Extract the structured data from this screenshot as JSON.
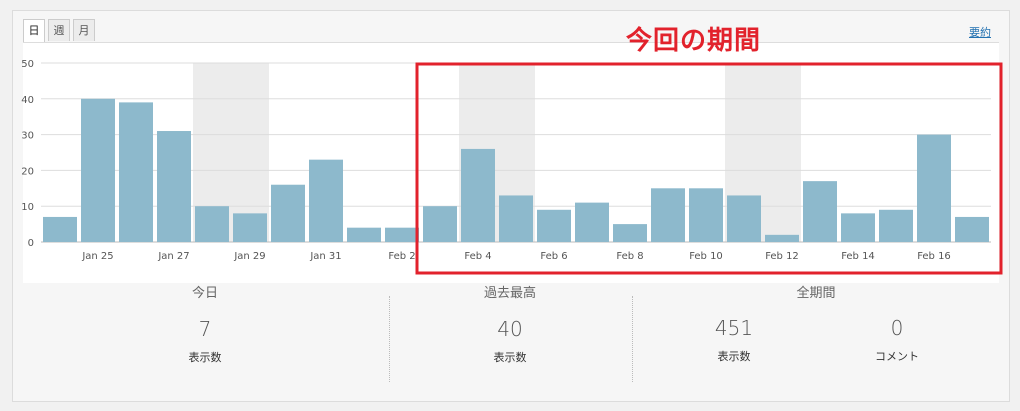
{
  "tabs": [
    {
      "label": "日",
      "active": true
    },
    {
      "label": "週",
      "active": false
    },
    {
      "label": "月",
      "active": false
    }
  ],
  "summary_link": "要約",
  "annotation": {
    "title": "今回の期間",
    "color": "#e2222c"
  },
  "chart_data": {
    "type": "bar",
    "ylim": [
      0,
      50
    ],
    "yticks": [
      0,
      10,
      20,
      30,
      40,
      50
    ],
    "x_tick_labels": [
      "Jan 25",
      "Jan 27",
      "Jan 29",
      "Jan 31",
      "Feb 2",
      "Feb 4",
      "Feb 6",
      "Feb 8",
      "Feb 10",
      "Feb 12",
      "Feb 14",
      "Feb 16"
    ],
    "values": [
      7,
      40,
      39,
      31,
      10,
      8,
      16,
      23,
      4,
      4,
      10,
      26,
      13,
      9,
      11,
      5,
      15,
      15,
      13,
      2,
      17,
      8,
      9,
      30,
      7
    ],
    "bar_color": "#8db9cc",
    "weekend_bands": [
      [
        4,
        5
      ],
      [
        11,
        12
      ],
      [
        18,
        19
      ]
    ],
    "grid": true
  },
  "stats": {
    "today": {
      "label": "今日",
      "value": "7",
      "sub": "表示数"
    },
    "best": {
      "label": "過去最高",
      "value": "40",
      "sub": "表示数"
    },
    "all_time": {
      "label": "全期間",
      "views": "451",
      "views_sub": "表示数",
      "comments": "0",
      "comments_sub": "コメント"
    }
  }
}
